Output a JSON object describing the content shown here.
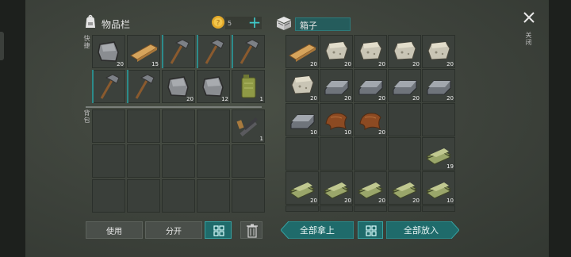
{
  "inventory": {
    "title": "物品栏",
    "coins": "5",
    "hotbar_label": "快捷",
    "backpack_label": "背包",
    "hotbar_row1": [
      {
        "item": "stone-icon",
        "count": "20"
      },
      {
        "item": "wood-plank-icon",
        "count": "15"
      },
      {
        "item": "stone-hatchet-icon",
        "count": ""
      },
      {
        "item": "stone-hatchet-icon",
        "count": ""
      },
      {
        "item": "stone-hatchet-icon",
        "count": ""
      }
    ],
    "hotbar_row2": [
      {
        "item": "stone-hatchet-icon",
        "count": ""
      },
      {
        "item": "stone-hatchet-icon",
        "count": ""
      },
      {
        "item": "stone-icon",
        "count": "20"
      },
      {
        "item": "stone-icon",
        "count": "12"
      },
      {
        "item": "jerrycan-icon",
        "count": "1"
      }
    ],
    "backpack_item": {
      "item": "crossbow-parts-icon",
      "count": "1"
    }
  },
  "chest": {
    "title": "箱子",
    "rows": [
      [
        {
          "item": "wood-plank-icon",
          "count": "20"
        },
        {
          "item": "limestone-icon",
          "count": "20"
        },
        {
          "item": "limestone-icon",
          "count": "20"
        },
        {
          "item": "limestone-icon",
          "count": "20"
        },
        {
          "item": "limestone-icon",
          "count": "20"
        }
      ],
      [
        {
          "item": "limestone-icon",
          "count": "20"
        },
        {
          "item": "iron-ingot-icon",
          "count": "20"
        },
        {
          "item": "iron-ingot-icon",
          "count": "20"
        },
        {
          "item": "iron-ingot-icon",
          "count": "20"
        },
        {
          "item": "iron-ingot-icon",
          "count": "20"
        }
      ],
      [
        {
          "item": "iron-ingot-icon",
          "count": "10"
        },
        {
          "item": "leather-icon",
          "count": "10"
        },
        {
          "item": "leather-icon",
          "count": "20"
        },
        {
          "item": "",
          "count": ""
        },
        {
          "item": "",
          "count": ""
        }
      ],
      [
        {
          "item": "",
          "count": ""
        },
        {
          "item": "",
          "count": ""
        },
        {
          "item": "",
          "count": ""
        },
        {
          "item": "",
          "count": ""
        },
        {
          "item": "cloth-icon",
          "count": "19"
        }
      ],
      [
        {
          "item": "cloth-icon",
          "count": "20"
        },
        {
          "item": "cloth-icon",
          "count": "20"
        },
        {
          "item": "cloth-icon",
          "count": "20"
        },
        {
          "item": "cloth-icon",
          "count": "20"
        },
        {
          "item": "cloth-icon",
          "count": "10"
        }
      ]
    ]
  },
  "buttons": {
    "use": "使用",
    "split": "分开",
    "take_all": "全部拿上",
    "put_all": "全部放入",
    "close": "关闭"
  }
}
